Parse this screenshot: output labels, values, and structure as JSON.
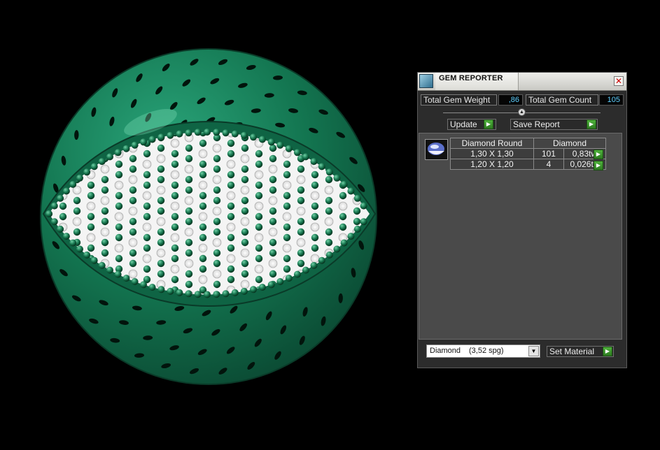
{
  "panel": {
    "title": "GEM REPORTER",
    "icons": {
      "app": "gem-reporter-icon",
      "close": "close-icon"
    },
    "total_gem_weight_label": "Total Gem Weight",
    "total_gem_weight_value": ",86",
    "total_gem_count_label": "Total Gem Count",
    "total_gem_count_value": "105",
    "update_label": "Update",
    "save_report_label": "Save Report",
    "table": {
      "headers": [
        "Diamond Round",
        "Diamond"
      ],
      "rows": [
        {
          "size": "1,30 X 1,30",
          "count": "101",
          "weight": "0,83tw"
        },
        {
          "size": "1,20 X 1,20",
          "count": "4",
          "weight": "0,026tw"
        }
      ]
    },
    "material": {
      "name": "Diamond",
      "sg": "(3,52 spg)"
    },
    "set_material_label": "Set Material"
  },
  "colors": {
    "metal": "#157a55",
    "accent_value": "#5fd0ff",
    "arrow_button": "#3a9a2a"
  }
}
